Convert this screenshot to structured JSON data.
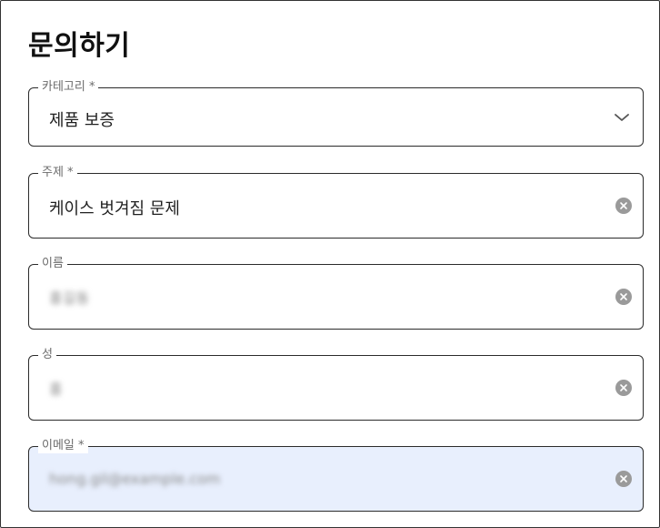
{
  "form": {
    "title": "문의하기",
    "category": {
      "label": "카테고리 *",
      "value": "제품 보증"
    },
    "subject": {
      "label": "주제 *",
      "value": "케이스 벗겨짐 문제"
    },
    "first_name": {
      "label": "이름",
      "value": "홍길동"
    },
    "last_name": {
      "label": "성",
      "value": "홍"
    },
    "email": {
      "label": "이메일 *",
      "value": "hong.gil@example.com"
    }
  },
  "icons": {
    "clear": "clear-icon",
    "dropdown": "chevron-down-icon"
  },
  "colors": {
    "autofill_bg": "#e8effd",
    "border": "#2b2b2b",
    "clear_icon": "#9a9a9a"
  }
}
